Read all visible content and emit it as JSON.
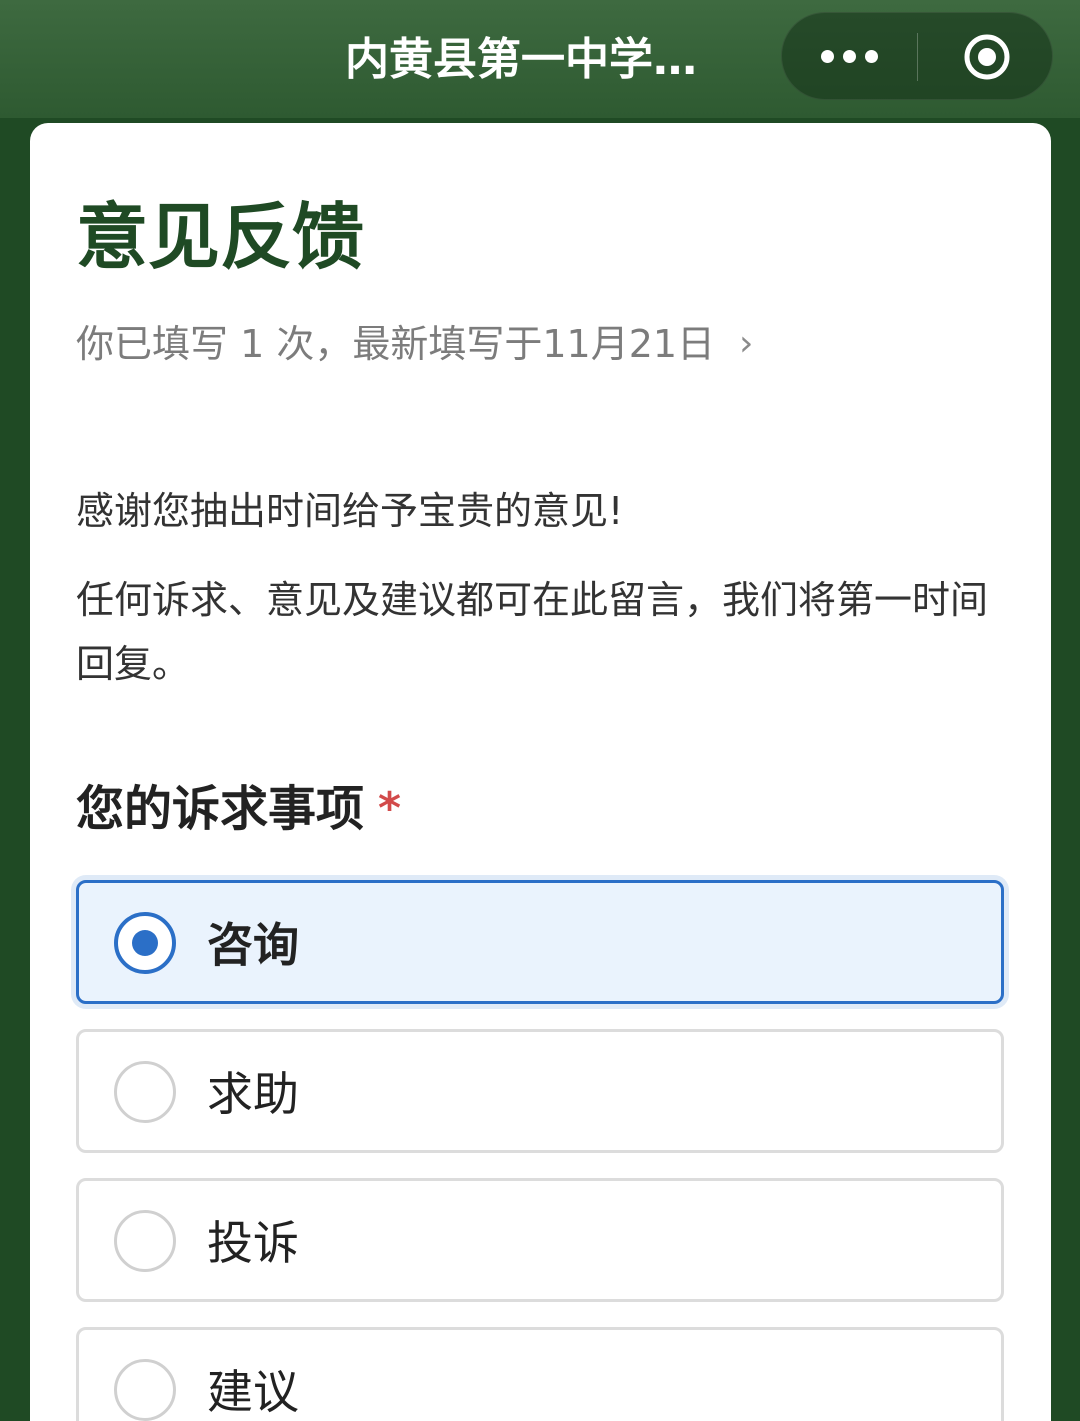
{
  "header": {
    "title": "内黄县第一中学…",
    "more_icon": "more-dots-icon",
    "close_icon": "target-close-icon"
  },
  "form": {
    "title": "意见反馈",
    "history": "你已填写  1  次，最新填写于11月21日",
    "history_chevron": "›",
    "intro_line1": "感谢您抽出时间给予宝贵的意见!",
    "intro_line2": "任何诉求、意见及建议都可在此留言，我们将第一时间回复。"
  },
  "question": {
    "label": "您的诉求事项",
    "required_mark": "*",
    "options": [
      {
        "label": "咨询",
        "selected": true
      },
      {
        "label": "求助",
        "selected": false
      },
      {
        "label": "投诉",
        "selected": false
      },
      {
        "label": "建议",
        "selected": false
      }
    ]
  },
  "colors": {
    "brand_green": "#1f4a24",
    "accent_blue": "#2b6fc7",
    "required_red": "#d24a4a"
  }
}
